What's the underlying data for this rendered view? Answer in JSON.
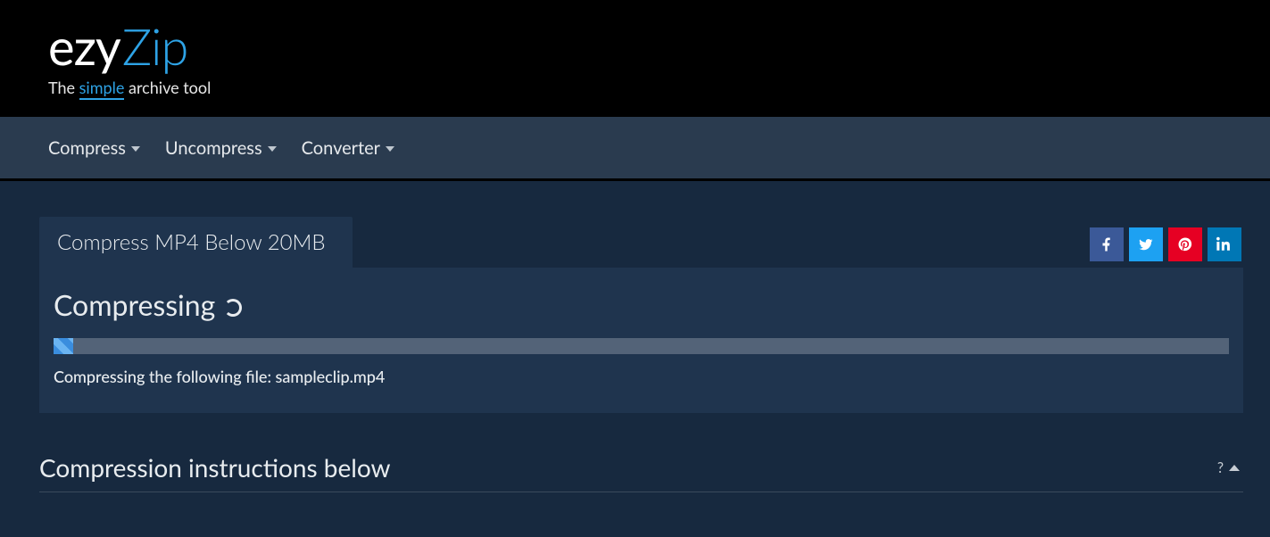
{
  "brand": {
    "part1": "ezy",
    "part2": "Zip",
    "tagline_pre": "The ",
    "tagline_mid": "simple",
    "tagline_post": " archive tool"
  },
  "nav": {
    "items": [
      {
        "label": "Compress"
      },
      {
        "label": "Uncompress"
      },
      {
        "label": "Converter"
      }
    ]
  },
  "tab": {
    "title": "Compress MP4 Below 20MB"
  },
  "social": {
    "facebook": "facebook-share",
    "twitter": "twitter-share",
    "pinterest": "pinterest-share",
    "linkedin": "linkedin-share"
  },
  "panel": {
    "heading": "Compressing",
    "status_prefix": "Compressing the following file: ",
    "filename": "sampleclip.mp4",
    "progress_percent": 1.5
  },
  "instructions": {
    "title": "Compression instructions below",
    "help_symbol": "?"
  },
  "colors": {
    "accent": "#2ea3e6",
    "panel_bg": "#1f344e",
    "page_bg": "#17293f",
    "nav_bg": "#2a3b4f"
  }
}
